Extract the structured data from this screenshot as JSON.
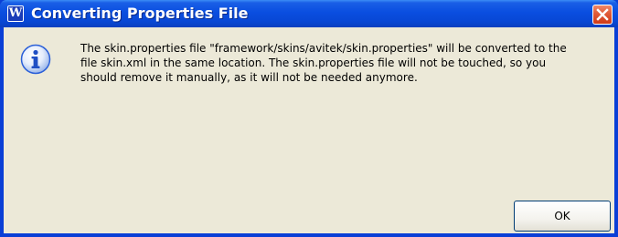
{
  "window": {
    "title": "Converting Properties File",
    "app_icon_glyph": "W",
    "app_icon": "app-logo-icon",
    "close_icon": "close-icon"
  },
  "dialog": {
    "icon": "info-icon",
    "message": "The skin.properties file \"framework/skins/avitek/skin.properties\" will be converted to the file skin.xml in the same location. The skin.properties file will not be touched, so you should remove it manually, as it will not be needed anymore.",
    "ok_label": "OK"
  },
  "colors": {
    "titlebar": "#0a4ee0",
    "frame": "#0a3fd6",
    "dialog_background": "#ece9d8",
    "close_button": "#e05a38",
    "info_icon": "#2a5fd8"
  }
}
